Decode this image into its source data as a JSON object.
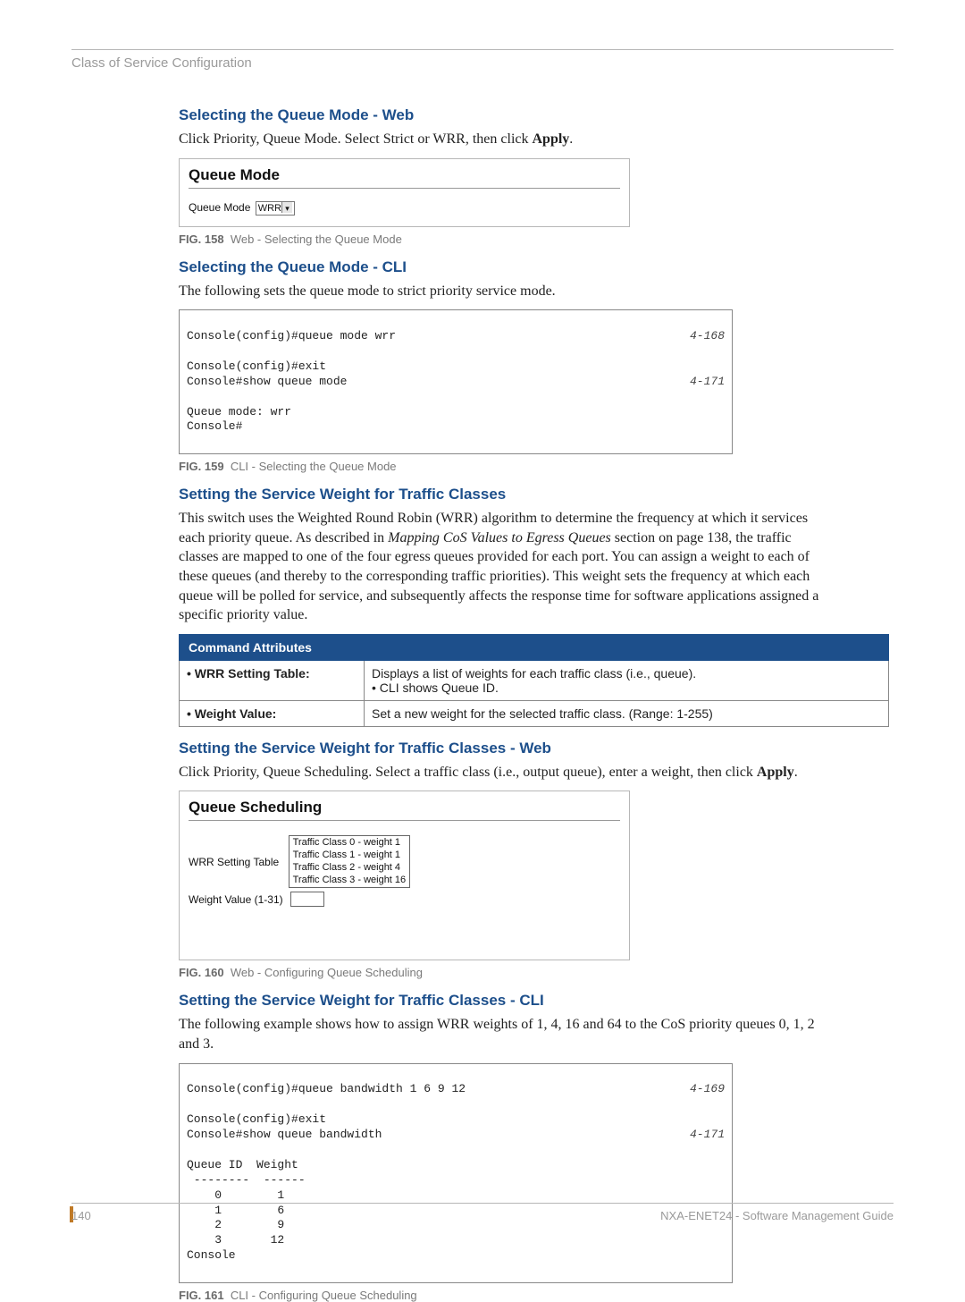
{
  "runningHead": "Class of Service Configuration",
  "sec1": {
    "heading": "Selecting the Queue Mode - Web",
    "para_a": "Click Priority, Queue Mode. Select Strict or WRR, then click ",
    "apply": "Apply",
    "para_b": "."
  },
  "fig158": {
    "boxTitle": "Queue Mode",
    "label": "Queue Mode",
    "selectValue": "WRR",
    "num": "FIG. 158",
    "caption": "Web - Selecting the Queue Mode"
  },
  "sec2": {
    "heading": "Selecting the Queue Mode - CLI",
    "para": "The following sets the queue mode to strict priority service mode."
  },
  "cli159": {
    "l1": "Console(config)#queue mode wrr",
    "r1": "4-168",
    "l2": "Console(config)#exit",
    "l3": "Console#show queue mode",
    "r3": "4-171",
    "l4": "Queue mode: wrr",
    "l5": "Console#"
  },
  "fig159": {
    "num": "FIG. 159",
    "caption": "CLI - Selecting the Queue Mode"
  },
  "sec3": {
    "heading": "Setting the Service Weight for Traffic Classes",
    "p_a": "This switch uses the Weighted Round Robin (WRR) algorithm to determine the frequency at which it services each priority queue. As described in ",
    "p_i": "Mapping CoS Values to Egress Queues",
    "p_b": " section on page 138, the traffic classes are mapped to one of the four egress queues provided for each port. You can assign a weight to each of these queues (and thereby to the corresponding traffic priorities). This weight sets the frequency at which each queue will be polled for service, and subsequently affects the response time for software applications assigned a specific priority value."
  },
  "cmdTable": {
    "header": "Command Attributes",
    "r1_lbl": "• WRR Setting Table:",
    "r1_val": "Displays a list of weights for each traffic class (i.e., queue).",
    "r1_sub": "•  CLI shows Queue ID.",
    "r2_lbl": "• Weight Value:",
    "r2_val": "Set a new weight for the selected traffic class. (Range: 1-255)"
  },
  "sec4": {
    "heading": "Setting the Service Weight for Traffic Classes - Web",
    "para_a": "Click Priority, Queue Scheduling. Select a traffic class (i.e., output queue), enter a weight, then click ",
    "apply": "Apply",
    "para_b": "."
  },
  "fig160": {
    "boxTitle": "Queue Scheduling",
    "wrrLabel": "WRR Setting Table",
    "opt0": "Traffic Class 0 - weight 1",
    "opt1": "Traffic Class 1 - weight 1",
    "opt2": "Traffic Class 2 - weight 4",
    "opt3": "Traffic Class 3 - weight 16",
    "wvLabel": "Weight Value (1-31)",
    "num": "FIG. 160",
    "caption": "Web - Configuring Queue Scheduling"
  },
  "sec5": {
    "heading": "Setting the Service Weight for Traffic Classes - CLI",
    "para": "The following example shows how to assign WRR weights of 1, 4, 16 and 64 to the CoS priority queues 0, 1, 2 and 3."
  },
  "cli161": {
    "l1": "Console(config)#queue bandwidth 1 6 9 12",
    "r1": "4-169",
    "l2": "Console(config)#exit",
    "l3": "Console#show queue bandwidth",
    "r3": "4-171",
    "l4": "Queue ID  Weight",
    "l5": " --------  ------",
    "l6": "    0        1",
    "l7": "    1        6",
    "l8": "    2        9",
    "l9": "    3       12",
    "l10": "Console"
  },
  "fig161": {
    "num": "FIG. 161",
    "caption": "CLI - Configuring Queue Scheduling"
  },
  "footer": {
    "pageNum": "140",
    "docTitle": "NXA-ENET24 - Software Management Guide"
  }
}
